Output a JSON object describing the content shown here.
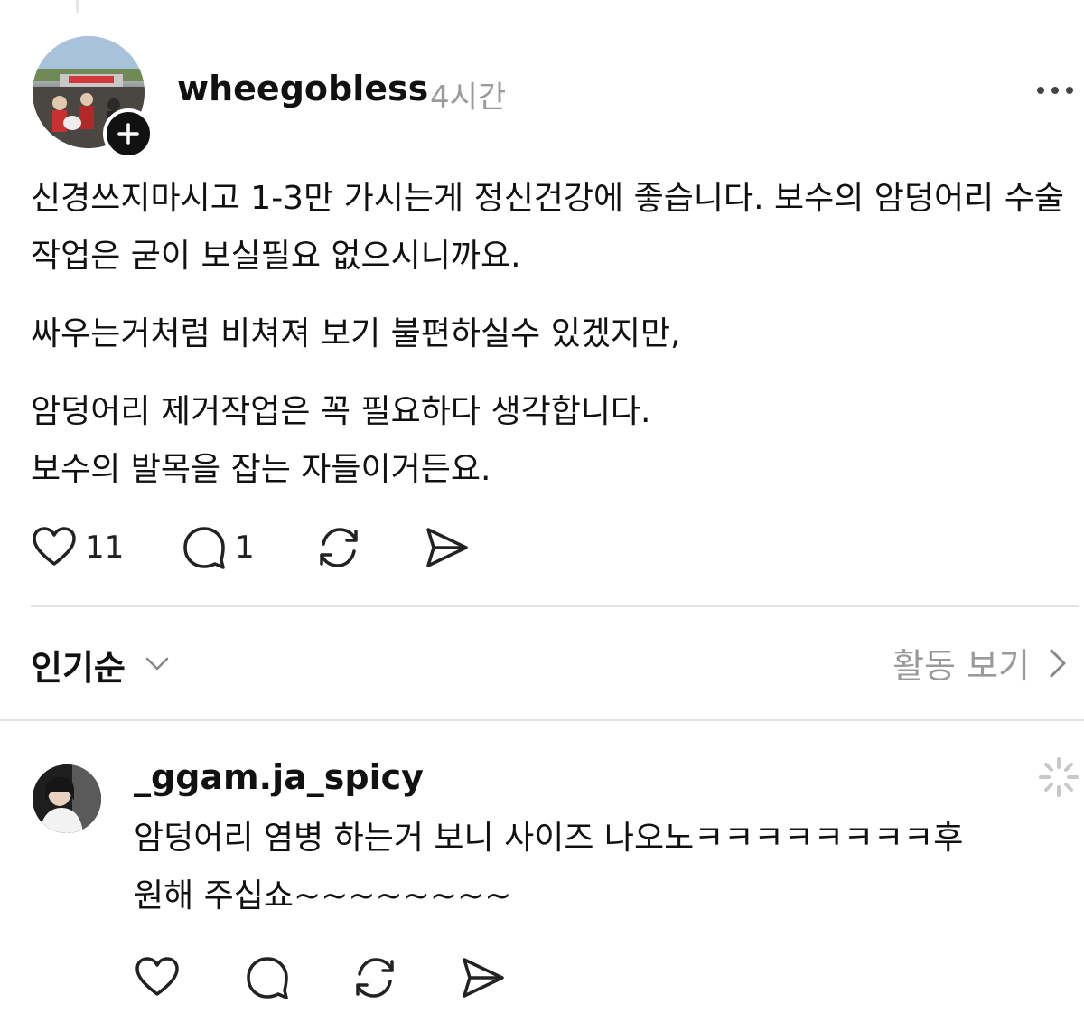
{
  "post": {
    "username": "wheegobless",
    "time": "4시간",
    "paragraphs": [
      "신경쓰지마시고 1-3만 가시는게 정신건강에 좋습니다. 보수의 암덩어리 수술작업은 굳이 보실필요 없으시니까요.",
      "싸우는거처럼 비쳐져 보기 불편하실수 있겠지만,",
      "암덩어리 제거작업은 꼭 필요하다 생각합니다.",
      "보수의 발목을 잡는 자들이거든요."
    ],
    "likes": "11",
    "comments": "1"
  },
  "sort": {
    "label": "인기순",
    "activity_label": "활동 보기"
  },
  "comment": {
    "username": "_ggam.ja_spicy",
    "lines": [
      "암덩어리 염병 하는거 보니 사이즈 나오노ㅋㅋㅋㅋㅋㅋㅋㅋ후",
      "원해 주십쇼~~~~~~~~"
    ]
  },
  "icons": [
    "heart-icon",
    "comment-icon",
    "repost-icon",
    "share-icon",
    "more-icon",
    "plus-icon",
    "chevron-down-icon",
    "chevron-right-icon",
    "spinner-icon"
  ]
}
